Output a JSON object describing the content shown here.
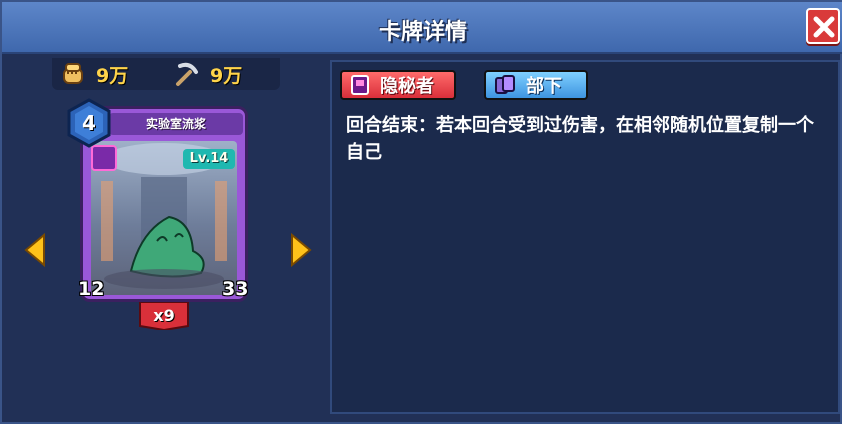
{
  "header": {
    "title": "卡牌详情",
    "close_icon": "close-icon"
  },
  "resources": [
    {
      "icon": "fist-icon",
      "value": "9万"
    },
    {
      "icon": "pickaxe-icon",
      "value": "9万"
    }
  ],
  "card": {
    "name": "实验室流浆",
    "cost": "4",
    "level": "Lv.14",
    "attack": "12",
    "health": "33",
    "count": "x9",
    "frame_color": "#9a58d8"
  },
  "navigation": {
    "prev_icon": "arrow-left-icon",
    "next_icon": "arrow-right-icon"
  },
  "details": {
    "tags": [
      {
        "label": "隐秘者",
        "icon": "book-icon",
        "color": "#d92f3a"
      },
      {
        "label": "部下",
        "icon": "cards-icon",
        "color": "#3e94e0"
      }
    ],
    "description": "回合结束：若本回合受到过伤害，在相邻随机位置复制一个自己"
  }
}
